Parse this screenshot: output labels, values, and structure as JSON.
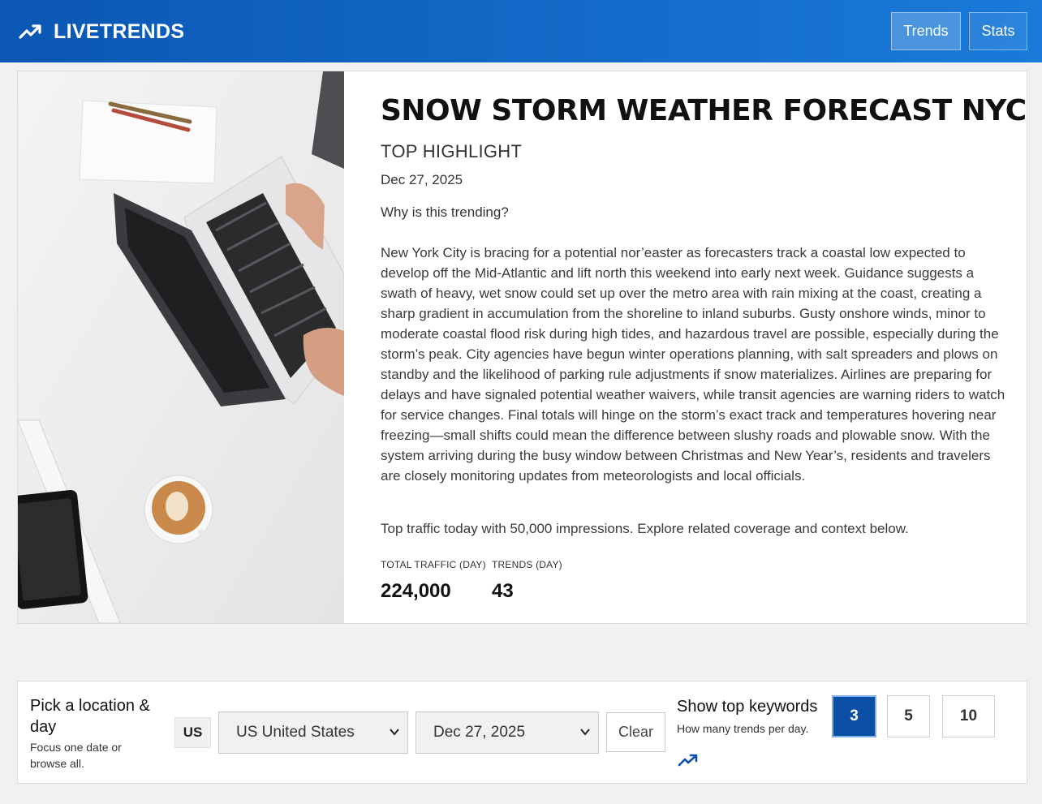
{
  "header": {
    "brand_name": "LIVETRENDS",
    "brand_icon": "trending-up-icon",
    "nav": [
      {
        "label": "Trends",
        "active": true
      },
      {
        "label": "Stats",
        "active": false
      }
    ]
  },
  "hero": {
    "title": "SNOW STORM WEATHER FORECAST NYC",
    "kicker": "TOP HIGHLIGHT",
    "date": "Dec 27, 2025",
    "why": "Why is this trending?",
    "body": "New York City is bracing for a potential nor’easter as forecasters track a coastal low expected to develop off the Mid-Atlantic and lift north this weekend into early next week. Guidance suggests a swath of heavy, wet snow could set up over the metro area with rain mixing at the coast, creating a sharp gradient in accumulation from the shoreline to inland suburbs. Gusty onshore winds, minor to moderate coastal flood risk during high tides, and hazardous travel are possible, especially during the storm’s peak. City agencies have begun winter operations planning, with salt spreaders and plows on standby and the likelihood of parking rule adjustments if snow materializes. Airlines are preparing for delays and have signaled potential weather waivers, while transit agencies are warning riders to watch for service changes. Final totals will hinge on the storm’s exact track and temperatures hovering near freezing—small shifts could mean the difference between slushy roads and plowable snow. With the system arriving during the busy window between Christmas and New Year’s, residents and travelers are closely monitoring updates from meteorologists and local officials.",
    "traffic_note": "Top traffic today with 50,000 impressions. Explore related coverage and context below.",
    "stats": [
      {
        "label": "TOTAL TRAFFIC (DAY)",
        "value": "224,000"
      },
      {
        "label": "TRENDS (DAY)",
        "value": "43"
      }
    ]
  },
  "filters": {
    "title": "Pick a location & day",
    "subtitle": "Focus one date or browse all.",
    "country_code": "US",
    "country_value": "US United States",
    "date_value": "Dec 27, 2025",
    "clear_label": "Clear",
    "keywords_title": "Show top keywords",
    "keywords_subtitle": "How many trends per day.",
    "counts": [
      "3",
      "5",
      "10"
    ],
    "selected_count": "3"
  },
  "colors": {
    "header_start": "#0b57b3",
    "header_end": "#1a7ad9",
    "accent": "#0b4fa6"
  }
}
